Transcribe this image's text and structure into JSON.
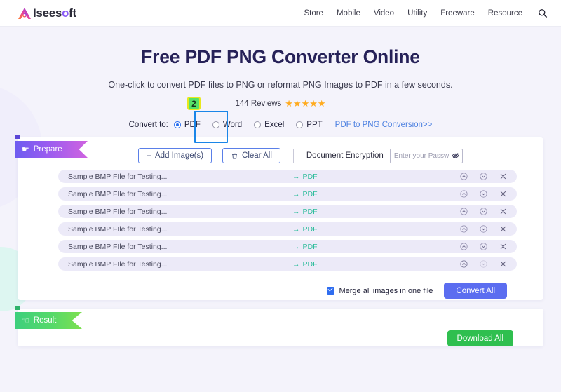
{
  "brand": {
    "name_prefix": "A",
    "name": "Iseesoft",
    "logo_icon": "aiseesoft-logo-icon"
  },
  "nav": {
    "items": [
      {
        "label": "Store"
      },
      {
        "label": "Mobile"
      },
      {
        "label": "Video"
      },
      {
        "label": "Utility"
      },
      {
        "label": "Freeware"
      },
      {
        "label": "Resource"
      }
    ],
    "search_icon": "search-icon"
  },
  "hero": {
    "title": "Free PDF PNG Converter Online",
    "subtitle": "One-click to convert PDF files to PNG or reformat PNG Images to PDF in a few seconds.",
    "reviews_count": "144 Reviews",
    "stars": "★★★★★"
  },
  "convert": {
    "label": "Convert to:",
    "options": [
      {
        "label": "PDF",
        "selected": true
      },
      {
        "label": "Word",
        "selected": false
      },
      {
        "label": "Excel",
        "selected": false
      },
      {
        "label": "PPT",
        "selected": false
      }
    ],
    "link": "PDF to PNG Conversion>>",
    "annotation": {
      "badge": "2",
      "badge_fill": "#56e168",
      "badge_border": "#e8e81c",
      "box_color": "#1a86e8"
    }
  },
  "prepare": {
    "banner_label": "Prepare",
    "banner_icon": "pointing-hand-icon",
    "add_images_label": "Add Image(s)",
    "add_images_icon": "plus-icon",
    "clear_all_label": "Clear All",
    "clear_all_icon": "trash-icon",
    "encryption_label": "Document Encryption",
    "password_placeholder": "Enter your Password.",
    "password_value": "",
    "password_toggle_icon": "eye-off-icon"
  },
  "files": {
    "target_arrow_icon": "arrow-right-icon",
    "move_up_icon": "circle-chevron-up-icon",
    "move_down_icon": "circle-chevron-down-icon",
    "remove_icon": "close-icon",
    "rows": [
      {
        "name": "Sample BMP FIle for Testing...",
        "target": "PDF",
        "can_move_down": true
      },
      {
        "name": "Sample BMP FIle for Testing...",
        "target": "PDF",
        "can_move_down": true
      },
      {
        "name": "Sample BMP FIle for Testing...",
        "target": "PDF",
        "can_move_down": true
      },
      {
        "name": "Sample BMP FIle for Testing...",
        "target": "PDF",
        "can_move_down": true
      },
      {
        "name": "Sample BMP FIle for Testing...",
        "target": "PDF",
        "can_move_down": true
      },
      {
        "name": "Sample BMP FIle for Testing...",
        "target": "PDF",
        "can_move_down": false
      }
    ]
  },
  "actions": {
    "merge_label": "Merge all images in one file",
    "merge_checked": true,
    "convert_all_label": "Convert All",
    "convert_all_color": "#5b6df0"
  },
  "result": {
    "banner_label": "Result",
    "banner_icon": "ok-hand-icon",
    "download_all_label": "Download All",
    "download_all_color": "#2fbf4f"
  }
}
